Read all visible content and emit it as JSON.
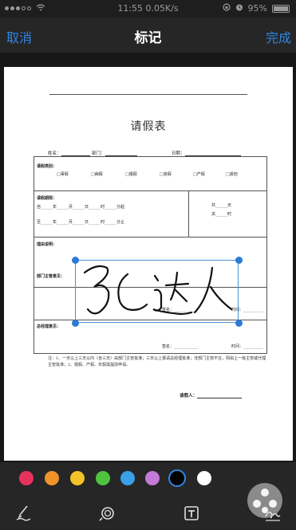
{
  "status_bar": {
    "time": "11:55 0.05K/s",
    "battery": "95%",
    "alarm_icon": "alarm-clock-icon",
    "lock_icon": "orientation-lock-icon",
    "wifi_icon": "wifi-icon"
  },
  "nav": {
    "cancel": "取消",
    "title": "标记",
    "done": "完成"
  },
  "document": {
    "title": "请假表",
    "name_label": "姓名：",
    "dept_label": "部门：",
    "date_label": "日期：",
    "leave_type_label": "请假类别：",
    "leave_types": [
      "□事假",
      "□病假",
      "□婚假",
      "□丧假",
      "□产假",
      "□其他"
    ],
    "leave_period_label": "请假期限：",
    "period_row1": [
      "自",
      "年",
      "月",
      "日",
      "时",
      "分起"
    ],
    "period_row2": [
      "至",
      "年",
      "月",
      "日",
      "时",
      "分止"
    ],
    "total_label_1": "共",
    "total_label_2": "天",
    "total_label_3": "关",
    "total_label_4": "时",
    "reason_label": "理由说明：",
    "dept_manager_label": "部门主管意见：",
    "sign_label_1": "签名：",
    "time_label_1": "时间：",
    "gm_label": "总经理意见：",
    "sign_label_2": "签名：",
    "time_label_2": "时间：",
    "note": "注：1、一天以上三天以内（含三天）由部门主管批准；三天以上报请总经理批准；非部门主管不在，则由上一级主管或代理主管批准；2、婚假、产假、年假需提前申请。",
    "applicant_label": "请假人："
  },
  "palette": {
    "colors": [
      "#e8325e",
      "#f0932b",
      "#f4c32a",
      "#4fc33f",
      "#3aa0e8",
      "#c37ad9",
      "#000000",
      "#ffffff"
    ],
    "selected_index": 6
  },
  "tools": {
    "pen_icon": "pen-icon",
    "magnifier_icon": "magnifier-icon",
    "text_icon": "text-box-icon",
    "signature_icon": "signature-icon"
  },
  "accent": "#2f86e8"
}
